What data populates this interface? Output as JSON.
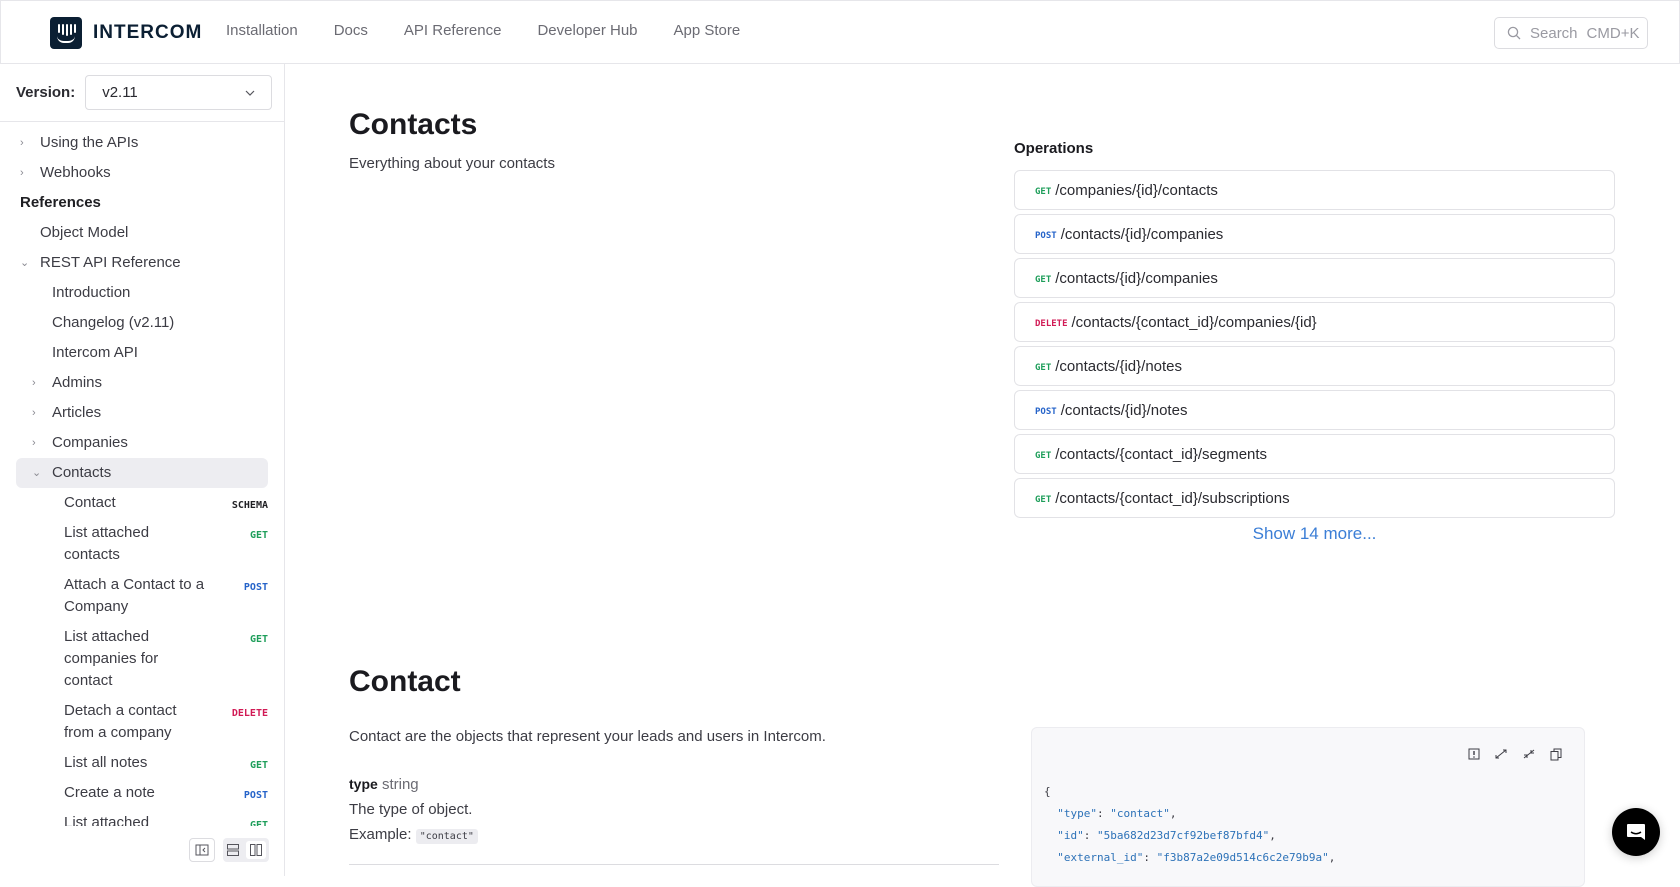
{
  "header": {
    "logo_text": "INTERCOM",
    "nav": [
      "Installation",
      "Docs",
      "API Reference",
      "Developer Hub",
      "App Store"
    ],
    "search_placeholder": "Search",
    "search_shortcut": "CMD+K"
  },
  "sidebar": {
    "version_label": "Version:",
    "version_value": "v2.11",
    "items": [
      {
        "label": "Using the APIs",
        "chevron": "right"
      },
      {
        "label": "Webhooks",
        "chevron": "right"
      },
      {
        "label": "References",
        "section": true
      },
      {
        "label": "Object Model"
      },
      {
        "label": "REST API Reference",
        "chevron": "down"
      },
      {
        "label": "Introduction"
      },
      {
        "label": "Changelog (v2.11)"
      },
      {
        "label": "Intercom API"
      },
      {
        "label": "Admins",
        "chevron": "right"
      },
      {
        "label": "Articles",
        "chevron": "right"
      },
      {
        "label": "Companies",
        "chevron": "right"
      },
      {
        "label": "Contacts",
        "chevron": "down",
        "active": true
      }
    ],
    "contact_items": [
      {
        "label": "Contact",
        "method": "SCHEMA"
      },
      {
        "label": "List attached contacts",
        "method": "GET"
      },
      {
        "label": "Attach a Contact to a Company",
        "method": "POST"
      },
      {
        "label": "List attached companies for contact",
        "method": "GET"
      },
      {
        "label": "Detach a contact from a company",
        "method": "DELETE"
      },
      {
        "label": "List all notes",
        "method": "GET"
      },
      {
        "label": "Create a note",
        "method": "POST"
      },
      {
        "label": "List attached",
        "method": "GET"
      }
    ]
  },
  "main": {
    "title": "Contacts",
    "description": "Everything about your contacts",
    "operations_title": "Operations",
    "operations": [
      {
        "method": "GET",
        "path": "/companies/{id}/contacts"
      },
      {
        "method": "POST",
        "path": "/contacts/{id}/companies"
      },
      {
        "method": "GET",
        "path": "/contacts/{id}/companies"
      },
      {
        "method": "DELETE",
        "path": "/contacts/{contact_id}/companies/{id}"
      },
      {
        "method": "GET",
        "path": "/contacts/{id}/notes"
      },
      {
        "method": "POST",
        "path": "/contacts/{id}/notes"
      },
      {
        "method": "GET",
        "path": "/contacts/{contact_id}/segments"
      },
      {
        "method": "GET",
        "path": "/contacts/{contact_id}/subscriptions"
      }
    ],
    "show_more": "Show 14 more...",
    "schema_title": "Contact",
    "schema_description": "Contact are the objects that represent your leads and users in Intercom.",
    "field": {
      "name": "type",
      "type": "string",
      "description": "The type of object.",
      "example_label": "Example:",
      "example_value": "\"contact\""
    },
    "code": {
      "open": "{",
      "lines": [
        {
          "key": "\"type\"",
          "value": "\"contact\""
        },
        {
          "key": "\"id\"",
          "value": "\"5ba682d23d7cf92bef87bfd4\""
        },
        {
          "key": "\"external_id\"",
          "value": "\"f3b87a2e09d514c6c2e79b9a\""
        }
      ]
    }
  },
  "colors": {
    "get": "#1e9e5a",
    "post": "#2563c9",
    "delete": "#d11a55",
    "link": "#3b7ed6",
    "brand": "#0b1f33"
  }
}
